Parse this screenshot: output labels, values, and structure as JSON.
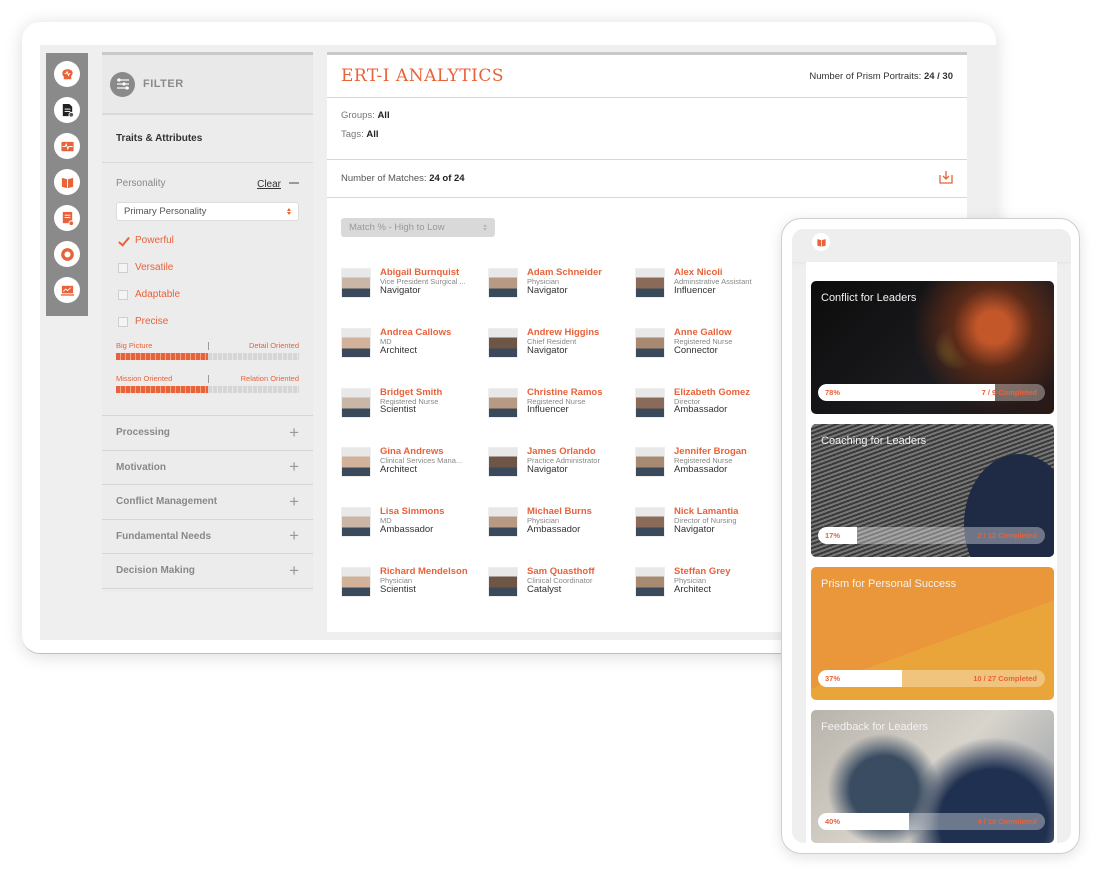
{
  "desktop": {
    "rail_icons": [
      "brain-icon",
      "document-check-icon",
      "heartbeat-icon",
      "book-icon",
      "certificate-icon",
      "ring-icon",
      "chart-laptop-icon"
    ],
    "filter": {
      "title": "FILTER",
      "section_title": "Traits & Attributes",
      "personality": {
        "label": "Personality",
        "clear_label": "Clear",
        "select_value": "Primary Personality",
        "options": [
          {
            "label": "Powerful",
            "checked": true
          },
          {
            "label": "Versatile",
            "checked": false
          },
          {
            "label": "Adaptable",
            "checked": false
          },
          {
            "label": "Precise",
            "checked": false
          }
        ],
        "sliders": [
          {
            "left": "Big Picture",
            "right": "Detail Oriented",
            "value_percent": 50
          },
          {
            "left": "Mission Oriented",
            "right": "Relation Oriented",
            "value_percent": 50
          }
        ]
      },
      "accordion": [
        "Processing",
        "Motivation",
        "Conflict Management",
        "Fundamental Needs",
        "Decision Making"
      ]
    },
    "main": {
      "title": "ERT-I ANALYTICS",
      "portraits_label": "Number of Prism Portraits:",
      "portraits_value": "24 / 30",
      "groups_label": "Groups:",
      "groups_value": "All",
      "tags_label": "Tags:",
      "tags_value": "All",
      "matches_label": "Number of Matches:",
      "matches_value": "24 of 24",
      "sort_value": "Match % - High to Low",
      "people": [
        {
          "name": "Abigail Burnquist",
          "role": "Vice President Surgical ...",
          "type": "Navigator"
        },
        {
          "name": "Adam Schneider",
          "role": "Physician",
          "type": "Navigator"
        },
        {
          "name": "Alex Nicoli",
          "role": "Adminstrative Assistant",
          "type": "Influencer"
        },
        {
          "name": "Andrea Callows",
          "role": "MD",
          "type": "Architect"
        },
        {
          "name": "Andrew Higgins",
          "role": "Chief Resident",
          "type": "Navigator"
        },
        {
          "name": "Anne Gallow",
          "role": "Registered Nurse",
          "type": "Connector"
        },
        {
          "name": "Bridget Smith",
          "role": "Registered Nurse",
          "type": "Scientist"
        },
        {
          "name": "Christine Ramos",
          "role": "Registered Nurse",
          "type": "Influencer"
        },
        {
          "name": "Elizabeth Gomez",
          "role": "Director",
          "type": "Ambassador"
        },
        {
          "name": "Gina Andrews",
          "role": "Clinical Services Mana...",
          "type": "Architect"
        },
        {
          "name": "James Orlando",
          "role": "Practice Administrator",
          "type": "Navigator"
        },
        {
          "name": "Jennifer Brogan",
          "role": "Registered Nurse",
          "type": "Ambassador"
        },
        {
          "name": "Lisa Simmons",
          "role": "MD",
          "type": "Ambassador"
        },
        {
          "name": "Michael Burns",
          "role": "Physician",
          "type": "Ambassador"
        },
        {
          "name": "Nick Lamantia",
          "role": "Director of Nursing",
          "type": "Navigator"
        },
        {
          "name": "Richard Mendelson",
          "role": "Physician",
          "type": "Scientist"
        },
        {
          "name": "Sam Quasthoff",
          "role": "Clinical Coordinator",
          "type": "Catalyst"
        },
        {
          "name": "Steffan Grey",
          "role": "Physician",
          "type": "Architect"
        }
      ]
    }
  },
  "tablet": {
    "header_icon": "book-icon",
    "courses": [
      {
        "title": "Conflict for Leaders",
        "percent": "78%",
        "progress": 78,
        "completed": "7 / 9 Completed"
      },
      {
        "title": "Coaching for Leaders",
        "percent": "17%",
        "progress": 17,
        "completed": "2 / 12 Completed"
      },
      {
        "title": "Prism for Personal Success",
        "percent": "37%",
        "progress": 37,
        "completed": "10 / 27 Completed"
      },
      {
        "title": "Feedback for Leaders",
        "percent": "40%",
        "progress": 40,
        "completed": "4 / 10 Completed"
      }
    ]
  },
  "colors": {
    "accent": "#e8623a",
    "rail": "#8a8a8a",
    "panel": "#ececec"
  }
}
